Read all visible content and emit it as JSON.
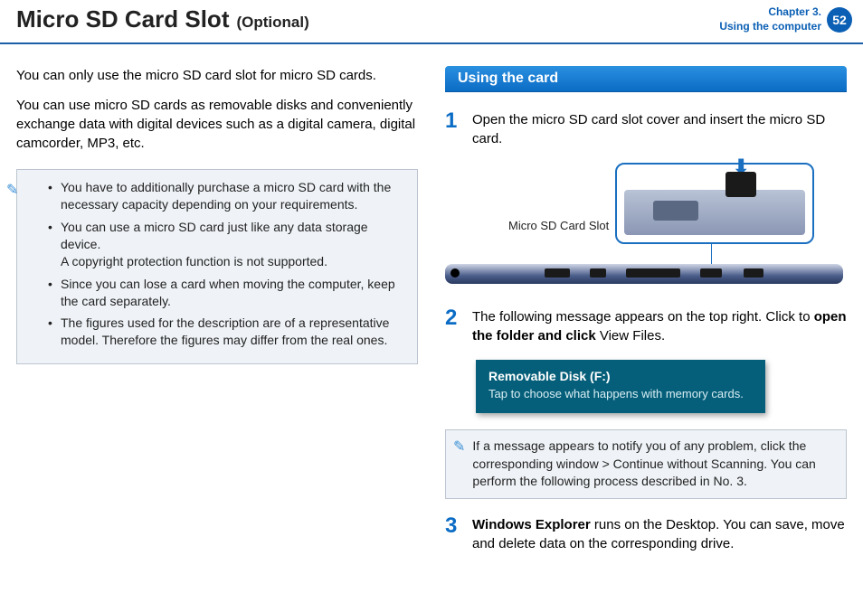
{
  "header": {
    "title": "Micro SD Card Slot",
    "subtitle": "(Optional)",
    "chapter_line1": "Chapter 3.",
    "chapter_line2": "Using the computer",
    "page_number": "52"
  },
  "intro": {
    "p1": "You can only use the micro SD card slot for micro SD cards.",
    "p2": "You can use micro SD cards as removable disks and conveniently exchange data with digital devices such as a digital camera, digital camcorder, MP3, etc."
  },
  "note": {
    "items": [
      "You have to additionally purchase a micro SD card with the necessary capacity depending on your requirements.",
      "You can use a micro SD card just like any data storage device.\nA copyright protection function is not supported.",
      "Since you can lose a card when moving the computer, keep the card separately.",
      "The figures used for the description are of a representative model. Therefore the figures may differ from the real ones."
    ]
  },
  "section_title": "Using the card",
  "steps": {
    "s1": {
      "num": "1",
      "text": "Open the micro SD card slot cover and insert the micro SD card."
    },
    "s2": {
      "num": "2",
      "pre": "The following message appears on the top right. Click to ",
      "bold": "open the folder and click",
      "post": " View Files."
    },
    "s3": {
      "num": "3",
      "bold": "Windows Explorer",
      "post": " runs on the Desktop. You can save, move and delete data on the corresponding drive."
    }
  },
  "diagram_label": "Micro SD Card Slot",
  "toast": {
    "title": "Removable Disk (F:)",
    "body": "Tap to choose what happens with memory cards."
  },
  "info": {
    "pre": "If a message appears to notify you of any problem, click the corresponding window > ",
    "bold": "Continue without Scanning",
    "post": ". You can perform the following process described in No. 3."
  }
}
